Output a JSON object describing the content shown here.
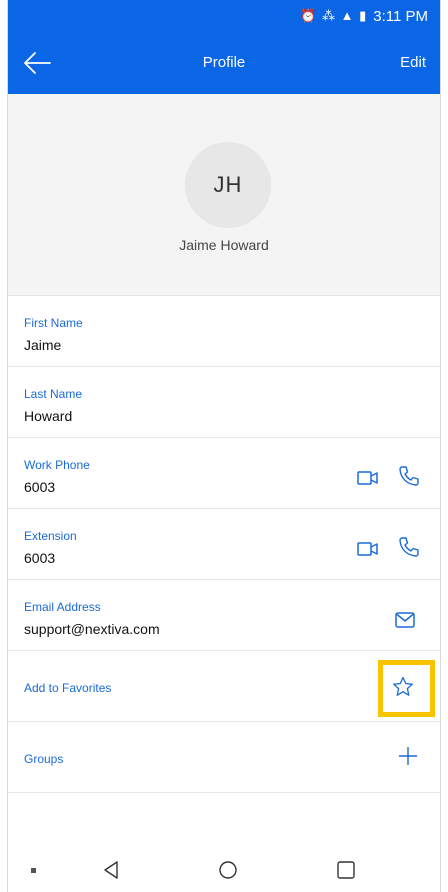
{
  "status": {
    "time": "3:11 PM",
    "icons": "⏰ ⁂ ▲ ▮"
  },
  "appbar": {
    "title": "Profile",
    "edit": "Edit"
  },
  "profile": {
    "initials": "JH",
    "full_name": "Jaime Howard"
  },
  "fields": [
    {
      "label": "First Name",
      "value": "Jaime"
    },
    {
      "label": "Last Name",
      "value": "Howard"
    },
    {
      "label": "Work Phone",
      "value": "6003"
    },
    {
      "label": "Extension",
      "value": "6003"
    },
    {
      "label": "Email Address",
      "value": "support@nextiva.com"
    }
  ],
  "actions": {
    "favorites": "Add to Favorites",
    "groups": "Groups"
  },
  "colors": {
    "brand": "#0a66e4",
    "label": "#1a6ad8",
    "highlight": "#f8c400"
  }
}
